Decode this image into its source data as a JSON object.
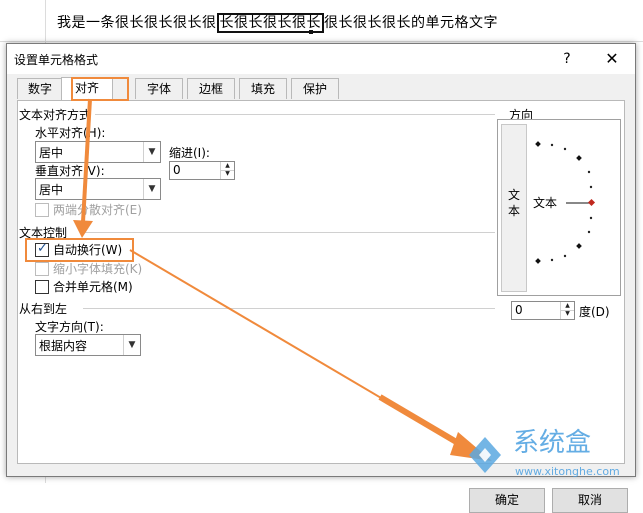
{
  "sheet": {
    "cell_before": "我是一条很长很长很长很",
    "cell_selected": "长很长很长很长",
    "cell_after": "很长很长很长的单元格文字"
  },
  "dialog": {
    "title": "设置单元格格式",
    "help": "?",
    "close": "✕",
    "tabs": [
      "数字",
      "对齐",
      "字体",
      "边框",
      "填充",
      "保护"
    ],
    "active_tab": "对齐",
    "text_alignment": {
      "heading": "文本对齐方式",
      "horizontal_label": "水平对齐(H):",
      "horizontal_value": "居中",
      "vertical_label": "垂直对齐(V):",
      "vertical_value": "居中",
      "indent_label": "缩进(I):",
      "indent_value": "0",
      "distributed_label": "两端分散对齐(E)"
    },
    "text_control": {
      "heading": "文本控制",
      "wrap_label": "自动换行(W)",
      "wrap_checked": true,
      "shrink_label": "缩小字体填充(K)",
      "merge_label": "合并单元格(M)"
    },
    "rtl": {
      "heading": "从右到左",
      "direction_label": "文字方向(T):",
      "direction_value": "根据内容"
    },
    "orientation": {
      "heading": "方向",
      "vertical_text": "文本",
      "dial_text": "文本",
      "degrees_value": "0",
      "degrees_label": "度(D)"
    },
    "buttons": {
      "ok": "确定",
      "cancel": "取消"
    }
  },
  "watermark": {
    "brand": "系统盒",
    "url": "www.xitonghe.com"
  },
  "colors": {
    "highlight": "#f08a3c",
    "dial_marker": "#c0281e"
  }
}
